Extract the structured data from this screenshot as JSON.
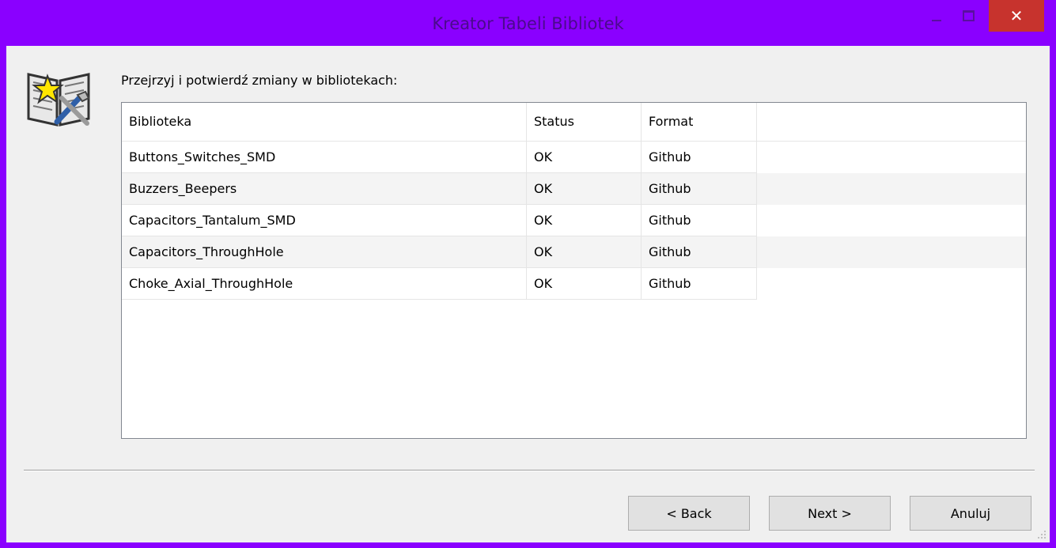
{
  "window": {
    "title": "Kreator Tabeli Bibliotek",
    "close_glyph": "✕"
  },
  "prompt": "Przejrzyj i potwierdź zmiany w bibliotekach:",
  "table": {
    "columns": [
      "Biblioteka",
      "Status",
      "Format"
    ],
    "rows": [
      [
        "Buttons_Switches_SMD",
        "OK",
        "Github"
      ],
      [
        "Buzzers_Beepers",
        "OK",
        "Github"
      ],
      [
        "Capacitors_Tantalum_SMD",
        "OK",
        "Github"
      ],
      [
        "Capacitors_ThroughHole",
        "OK",
        "Github"
      ],
      [
        "Choke_Axial_ThroughHole",
        "OK",
        "Github"
      ]
    ]
  },
  "buttons": {
    "back": "< Back",
    "next": "Next >",
    "cancel": "Anuluj"
  },
  "colors": {
    "frame": "#8a00ff",
    "close_button": "#c7332d",
    "client": "#f0f0f0"
  },
  "icons": {
    "wizard": "book-wizard-icon",
    "minimize": "minimize-icon",
    "maximize": "maximize-icon",
    "close": "close-icon"
  }
}
